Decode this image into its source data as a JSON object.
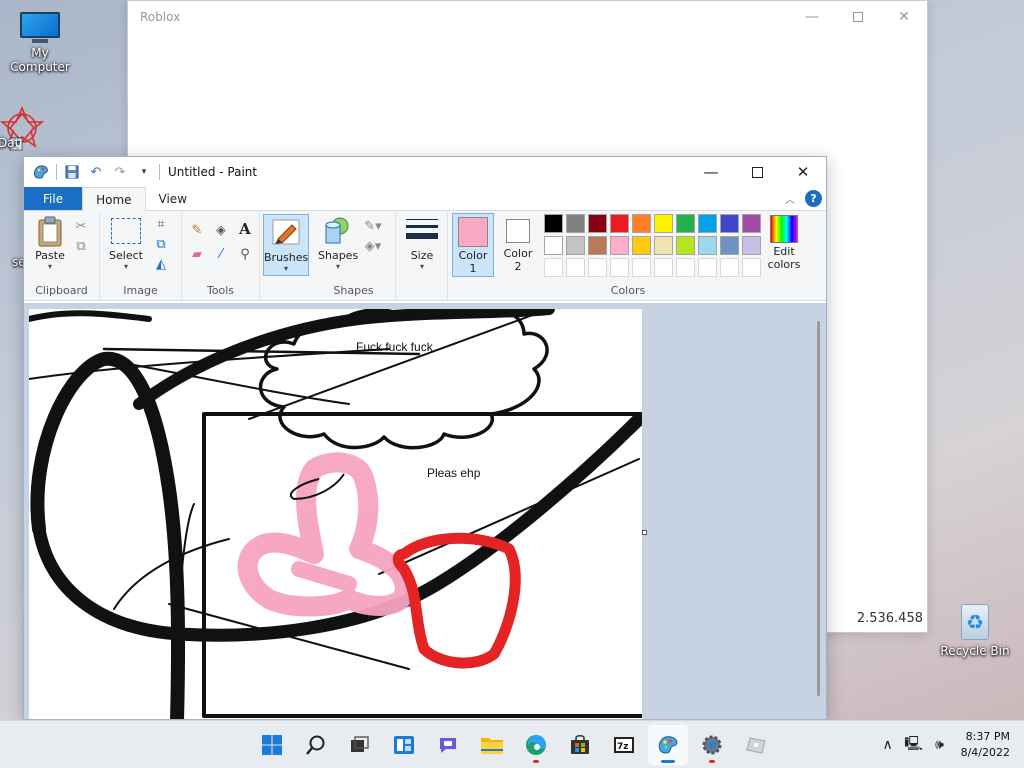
{
  "desktop": {
    "icons": [
      {
        "label": "My Computer"
      },
      {
        "label": "Dat"
      },
      {
        "label": "se"
      },
      {
        "label": "Recycle Bin"
      }
    ]
  },
  "roblox": {
    "title": "Roblox",
    "version": "2.536.458"
  },
  "paint": {
    "title": "Untitled - Paint",
    "tabs": {
      "file": "File",
      "home": "Home",
      "view": "View"
    },
    "clipboard": {
      "paste": "Paste",
      "label": "Clipboard"
    },
    "image": {
      "select": "Select",
      "label": "Image"
    },
    "tools": {
      "label": "Tools"
    },
    "brushes": {
      "label": "Brushes"
    },
    "shapes": {
      "button": "Shapes",
      "label": "Shapes"
    },
    "size": {
      "label": "Size"
    },
    "colors": {
      "color1": "Color",
      "color1_num": "1",
      "color2": "Color",
      "color2_num": "2",
      "edit1": "Edit",
      "edit2": "colors",
      "label": "Colors",
      "color1_value": "#f7a9c5",
      "color2_value": "#ffffff",
      "row1": [
        "#000000",
        "#7f7f7f",
        "#880015",
        "#ed1c24",
        "#ff7f27",
        "#fff200",
        "#22b14c",
        "#00a2e8",
        "#3f48cc",
        "#a349a4"
      ],
      "row2": [
        "#ffffff",
        "#c3c3c3",
        "#b97a57",
        "#ffaec9",
        "#ffc90e",
        "#efe4b0",
        "#b5e61d",
        "#99d9ea",
        "#7092be",
        "#c8bfe7"
      ]
    },
    "canvas_text": {
      "t1": "Fuck fuck fuck",
      "t2": "Pleas ehp"
    }
  },
  "taskbar": {
    "time": "8:37 PM",
    "date": "8/4/2022"
  }
}
